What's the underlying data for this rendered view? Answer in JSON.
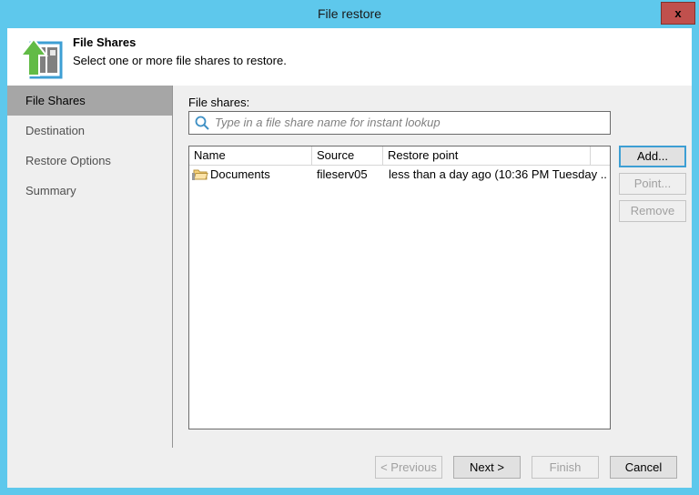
{
  "window": {
    "title": "File restore",
    "close_label": "x",
    "accent_color": "#5ec8ec",
    "close_color": "#c0504d"
  },
  "header": {
    "icon": "file-share-upload-icon",
    "title": "File Shares",
    "subtitle": "Select one or more file shares to restore."
  },
  "sidebar": {
    "items": [
      {
        "label": "File Shares",
        "active": true
      },
      {
        "label": "Destination",
        "active": false
      },
      {
        "label": "Restore Options",
        "active": false
      },
      {
        "label": "Summary",
        "active": false
      }
    ]
  },
  "main": {
    "field_label": "File shares:",
    "search": {
      "icon": "search-icon",
      "value": "",
      "placeholder": "Type in a file share name for instant lookup"
    },
    "table": {
      "columns": [
        "Name",
        "Source",
        "Restore point",
        ""
      ],
      "rows": [
        {
          "icon": "shared-folder-icon",
          "name": "Documents",
          "source": "fileserv05",
          "restore_point": "less than a day ago (10:36 PM Tuesday ..."
        }
      ]
    },
    "side_buttons": [
      {
        "label": "Add...",
        "enabled": true,
        "focused": true
      },
      {
        "label": "Point...",
        "enabled": false,
        "focused": false
      },
      {
        "label": "Remove",
        "enabled": false,
        "focused": false
      }
    ]
  },
  "footer": {
    "buttons": [
      {
        "label": "< Previous",
        "enabled": false
      },
      {
        "label": "Next >",
        "enabled": true
      },
      {
        "label": "Finish",
        "enabled": false
      },
      {
        "label": "Cancel",
        "enabled": true
      }
    ]
  }
}
